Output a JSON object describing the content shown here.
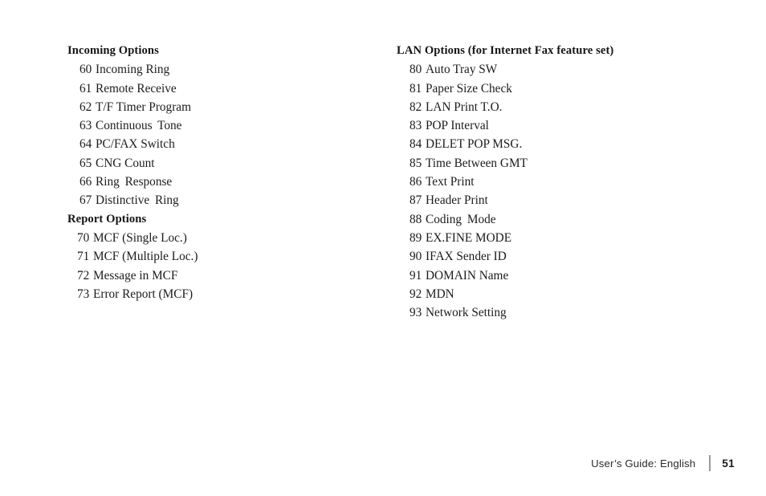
{
  "page": {
    "background_color": "#ffffff",
    "text_color": "#1a1a1a"
  },
  "left_column": {
    "sections": [
      {
        "header": "Incoming Options",
        "items": [
          {
            "num": "60",
            "label": "Incoming Ring"
          },
          {
            "num": "61",
            "label": "Remote Receive"
          },
          {
            "num": "62",
            "label": "T/F Timer Program"
          },
          {
            "num": "63",
            "label": "Continuous Tone"
          },
          {
            "num": "64",
            "label": "PC/FAX Switch"
          },
          {
            "num": "65",
            "label": "CNG Count"
          },
          {
            "num": "66",
            "label": "Ring Response"
          },
          {
            "num": "67",
            "label": "Distinctive Ring"
          }
        ]
      },
      {
        "header": "Report Options",
        "items": [
          {
            "num": "70",
            "label": "MCF (Single Loc.)"
          },
          {
            "num": "71",
            "label": "MCF (Multiple Loc.)"
          },
          {
            "num": "72",
            "label": "Message in MCF"
          },
          {
            "num": "73",
            "label": "Error Report (MCF)"
          }
        ]
      }
    ]
  },
  "right_column": {
    "sections": [
      {
        "header": "LAN Options (for Internet Fax feature set)",
        "items": [
          {
            "num": "80",
            "label": "Auto Tray SW"
          },
          {
            "num": "81",
            "label": "Paper Size Check"
          },
          {
            "num": "82",
            "label": "LAN Print T.O."
          },
          {
            "num": "83",
            "label": "POP Interval"
          },
          {
            "num": "84",
            "label": "DELET POP MSG."
          },
          {
            "num": "85",
            "label": "Time Between GMT"
          },
          {
            "num": "86",
            "label": "Text Print"
          },
          {
            "num": "87",
            "label": "Header Print"
          },
          {
            "num": "88",
            "label": "Coding Mode"
          },
          {
            "num": "89",
            "label": "EX.FINE MODE"
          },
          {
            "num": "90",
            "label": "IFAX Sender ID"
          },
          {
            "num": "91",
            "label": "DOMAIN Name"
          },
          {
            "num": "92",
            "label": "MDN"
          },
          {
            "num": "93",
            "label": "Network Setting"
          }
        ]
      }
    ]
  },
  "footer": {
    "guide_text": "User’s Guide:  English",
    "page_number": "51",
    "divider_color": "#9a9a9a"
  }
}
